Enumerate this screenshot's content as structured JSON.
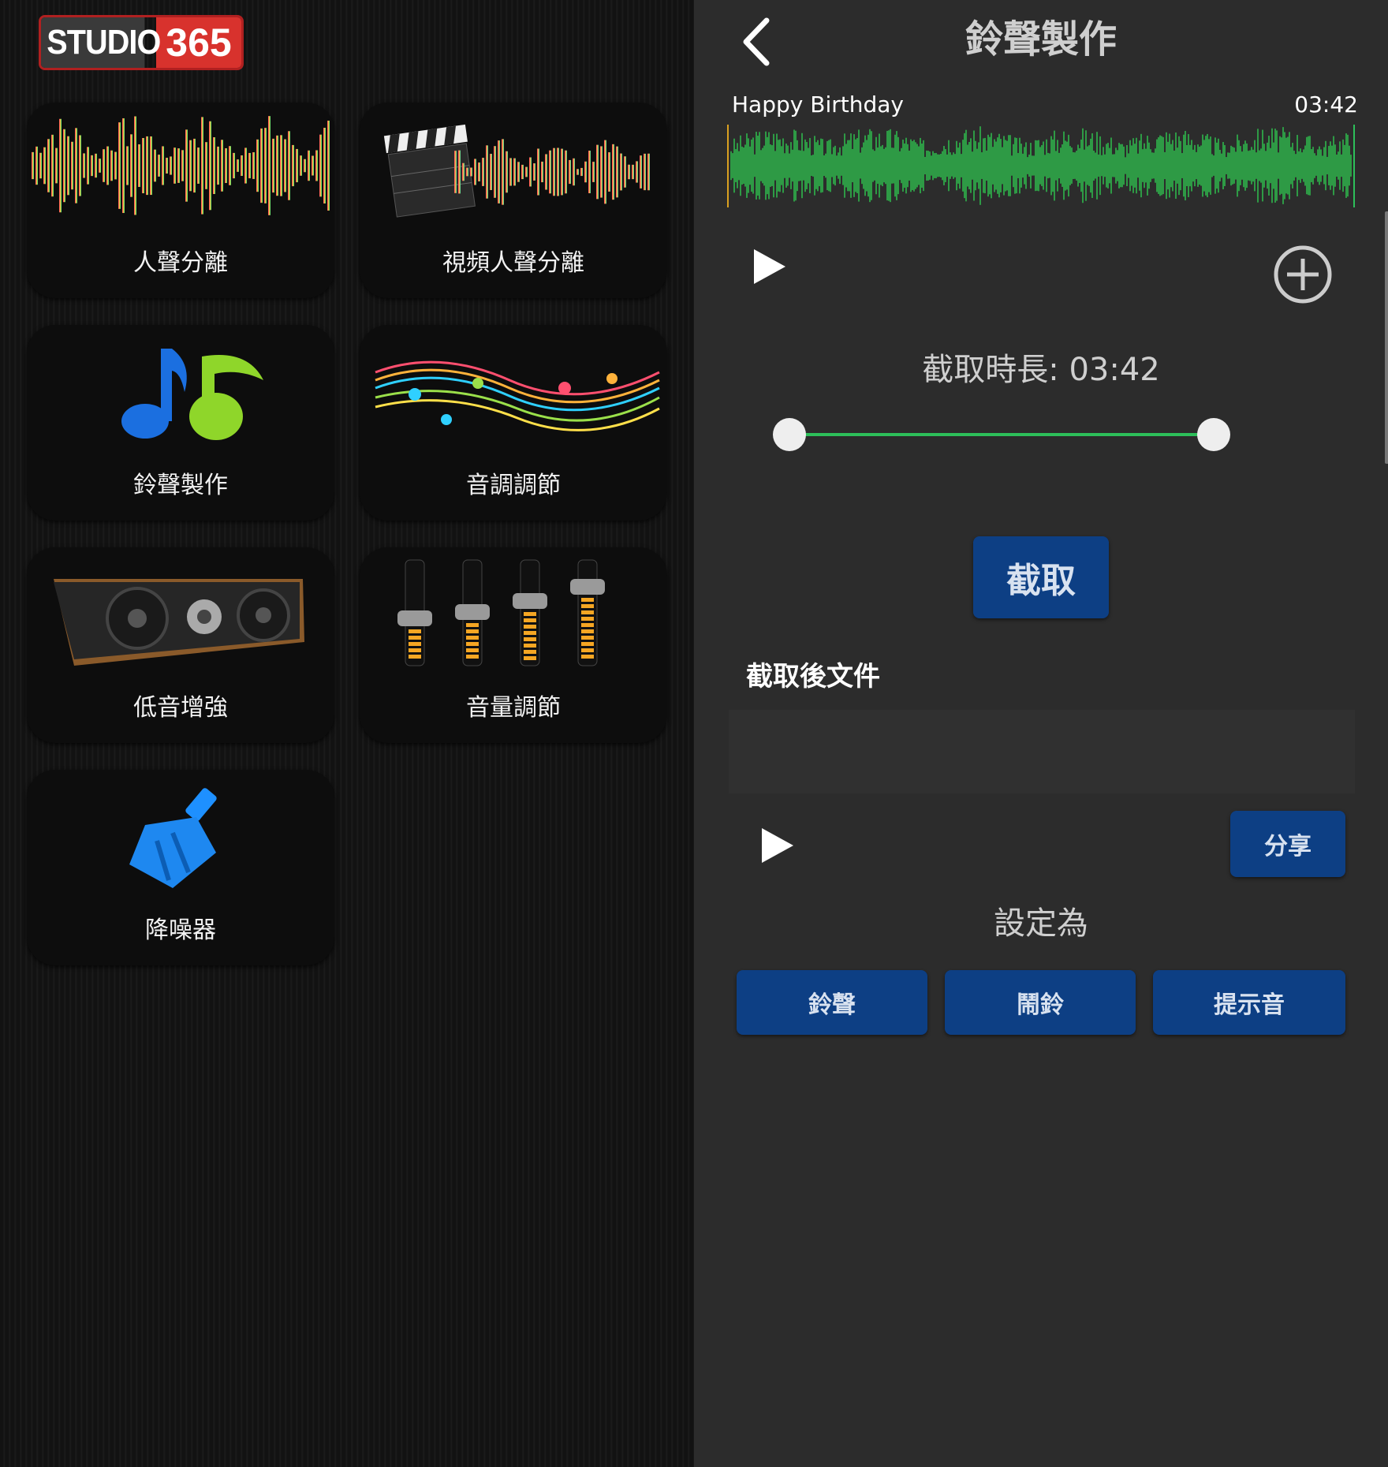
{
  "logo": {
    "part1": "STUDIO",
    "part2": "365"
  },
  "tiles": [
    {
      "label": "人聲分離",
      "icon": "waveform-icon"
    },
    {
      "label": "視頻人聲分離",
      "icon": "clapperboard-waveform-icon"
    },
    {
      "label": "鈴聲製作",
      "icon": "music-notes-icon"
    },
    {
      "label": "音調調節",
      "icon": "music-staff-icon"
    },
    {
      "label": "低音增強",
      "icon": "speaker-icon"
    },
    {
      "label": "音量調節",
      "icon": "equalizer-sliders-icon"
    },
    {
      "label": "降噪器",
      "icon": "broom-icon"
    }
  ],
  "editor": {
    "title": "鈴聲製作",
    "song_name": "Happy Birthday",
    "song_duration": "03:42",
    "duration_label": "截取時長: 03:42",
    "cut_button": "截取",
    "after_cut_label": "截取後文件",
    "share_button": "分享",
    "set_as_label": "設定為",
    "set_as_buttons": [
      "鈴聲",
      "鬧鈴",
      "提示音"
    ],
    "selection_start": 0,
    "selection_end": 1
  },
  "colors": {
    "accent_green": "#2dbf5a",
    "button_blue": "#0d3f84",
    "waveform_green": "#2e9a45",
    "logo_red": "#d8322d"
  }
}
